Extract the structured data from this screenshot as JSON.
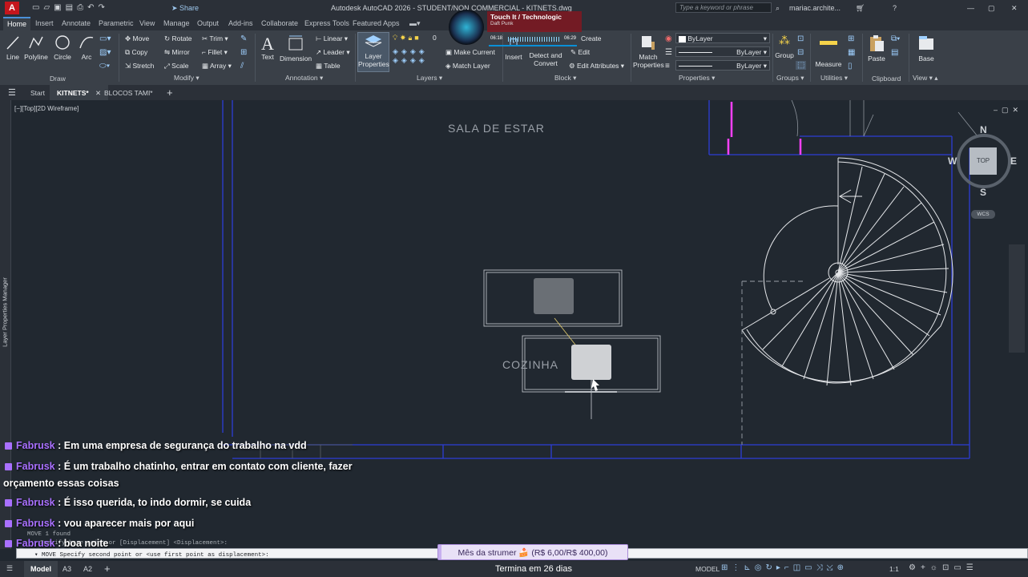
{
  "title_bar": {
    "title": "Autodesk AutoCAD 2026 - STUDENT/NON COMMERCIAL - KITNETS.dwg",
    "app_letter": "A",
    "share": "Share",
    "search_placeholder": "Type a keyword or phrase",
    "user": "mariac.archite..."
  },
  "music": {
    "title": "Touch It / Technologic",
    "artist": "Daft Punk",
    "elapsed": "06:18",
    "total": "06:29"
  },
  "ribbon_tabs": [
    "Home",
    "Insert",
    "Annotate",
    "Parametric",
    "View",
    "Manage",
    "Output",
    "Add-ins",
    "Collaborate",
    "Express Tools",
    "Featured Apps"
  ],
  "ribbon": {
    "draw": {
      "line": "Line",
      "polyline": "Polyline",
      "circle": "Circle",
      "arc": "Arc",
      "panel": "Draw"
    },
    "modify": {
      "move": "Move",
      "rotate": "Rotate",
      "trim": "Trim",
      "copy": "Copy",
      "mirror": "Mirror",
      "fillet": "Fillet",
      "stretch": "Stretch",
      "scale": "Scale",
      "array": "Array",
      "panel": "Modify"
    },
    "annotation": {
      "text": "Text",
      "dimension": "Dimension",
      "linear": "Linear",
      "leader": "Leader",
      "table": "Table",
      "panel": "Annotation"
    },
    "layers": {
      "layer_properties_1": "Layer",
      "layer_properties_2": "Properties",
      "current_layer": "0",
      "make_current": "Make Current",
      "match_layer": "Match Layer",
      "panel": "Layers"
    },
    "block": {
      "insert": "Insert",
      "create": "Create",
      "edit": "Edit",
      "detect_1": "Detect and",
      "detect_2": "Convert",
      "edit_attributes": "Edit Attributes",
      "panel": "Block"
    },
    "properties": {
      "match_1": "Match",
      "match_2": "Properties",
      "color": "ByLayer",
      "linetype": "ByLayer",
      "lineweight": "ByLayer",
      "panel": "Properties"
    },
    "groups": {
      "group": "Group",
      "panel": "Groups"
    },
    "utilities": {
      "measure": "Measure",
      "panel": "Utilities"
    },
    "clipboard": {
      "paste": "Paste",
      "panel": "Clipboard"
    },
    "view": {
      "base": "Base",
      "panel": "View"
    }
  },
  "doc_tabs": [
    "Start",
    "KITNETS*",
    "BLOCOS TAMI*"
  ],
  "viewport_label": "[−][Top][2D Wireframe]",
  "side_palette": "Layer Properties Manager",
  "drawing": {
    "room1": "SALA DE ESTAR",
    "room2": "COZINHA"
  },
  "viewcube": {
    "n": "N",
    "s": "S",
    "e": "E",
    "w": "W",
    "top": "TOP",
    "wcs": "WCS"
  },
  "chat": [
    {
      "user": "Fabrusk",
      "msg": ": Em uma empresa de segurança do trabalho na vdd"
    },
    {
      "user": "Fabrusk",
      "msg": ": É um trabalho chatinho, entrar em contato com cliente, fazer"
    },
    {
      "user": "",
      "msg": "orçamento essas coisas"
    },
    {
      "user": "Fabrusk",
      "msg": ": É isso querida, to indo dormir, se cuida"
    },
    {
      "user": "Fabrusk",
      "msg": ": vou aparecer mais por aqui"
    },
    {
      "user": "Fabrusk",
      "msg": ": boa noite"
    }
  ],
  "command": {
    "history1": "MOVE 1 found",
    "history2": "Specify base point or [Displacement] <Displacement>:",
    "current": "MOVE Specify second point or <use first point as displacement>:"
  },
  "goal": {
    "text": "Mês da strumer 🍰 (R$ 6,00/R$ 400,00)",
    "current": 6,
    "target": 400,
    "ends": "Termina em 26 dias"
  },
  "status": {
    "model": "Model",
    "layouts": [
      "A3",
      "A2"
    ],
    "model_right": "MODEL",
    "scale": "1:1"
  }
}
